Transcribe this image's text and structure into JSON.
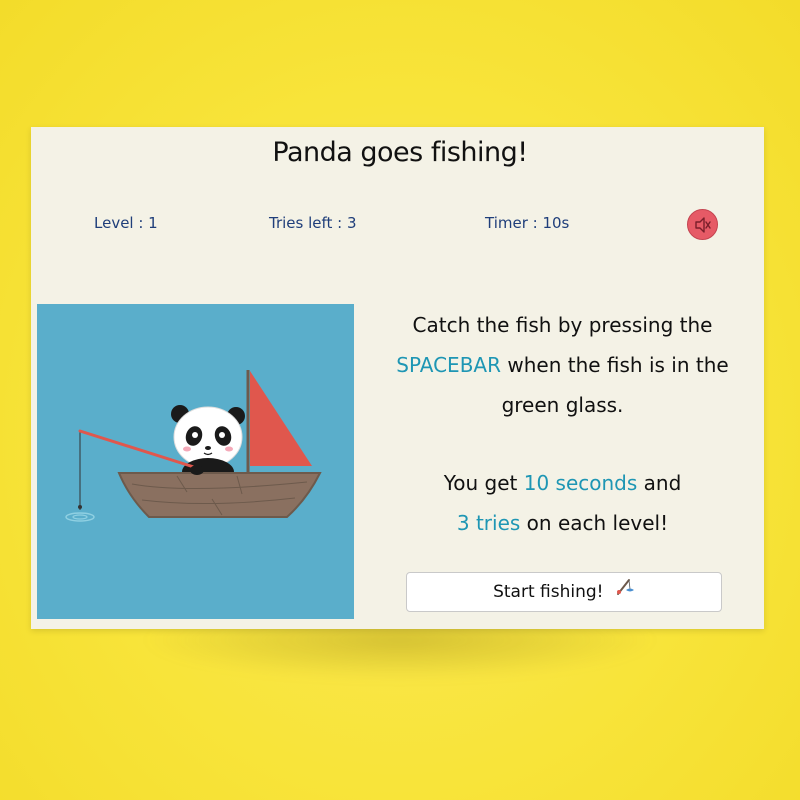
{
  "game": {
    "title": "Panda goes fishing!"
  },
  "stats": {
    "level": "Level : 1",
    "tries": "Tries left : 3",
    "timer": "Timer : 10s"
  },
  "controls": {
    "mute_icon": "speaker-muted-icon",
    "start_label": "Start fishing!",
    "start_icon": "fishing-rod-icon"
  },
  "instructions": {
    "line1": "Catch the fish by pressing the",
    "key": "SPACEBAR",
    "line2": " when the fish is in the",
    "line3": "green glass.",
    "get_pre": "You get ",
    "seconds": "10 seconds",
    "get_post": " and",
    "tries": "3 tries",
    "tries_post": " on each level!"
  },
  "colors": {
    "background": "#f9e53f",
    "card": "#f4f2e6",
    "highlight": "#1e96b4",
    "stat_text": "#1f3e7a",
    "scene_water": "#5aaecb",
    "sail": "#e0574d",
    "boat": "#8a7060",
    "mute_button": "#e65a66"
  }
}
